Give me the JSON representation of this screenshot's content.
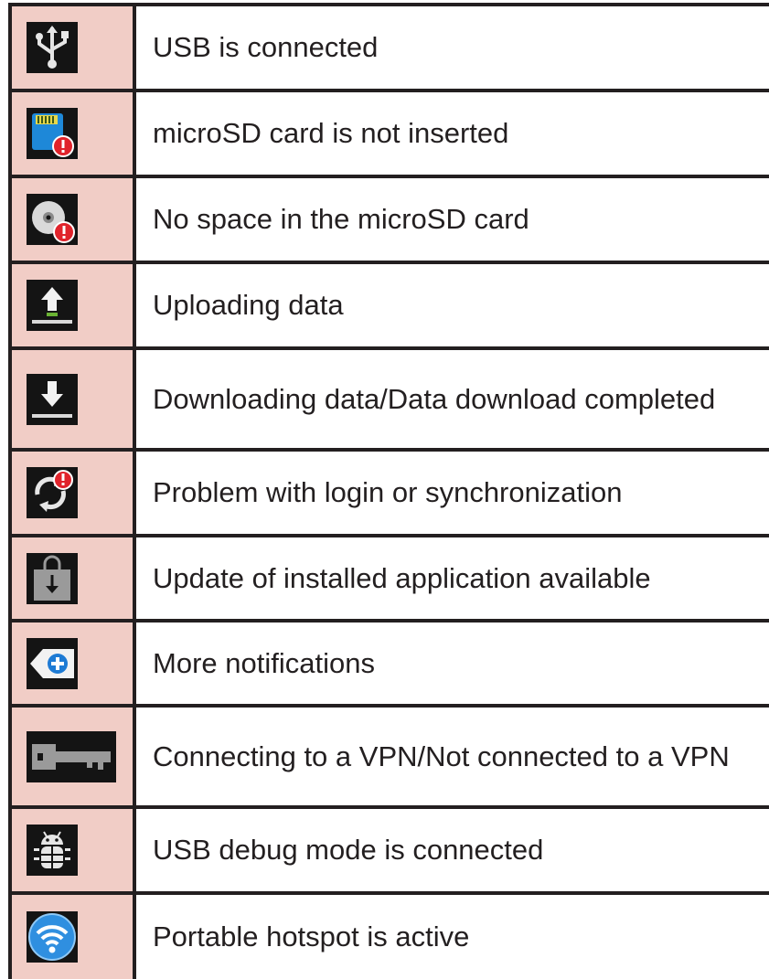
{
  "rows": [
    {
      "icon": "usb-icon",
      "text": "USB is connected"
    },
    {
      "icon": "microsd-not-inserted-icon",
      "text": "microSD card is not inserted"
    },
    {
      "icon": "disk-full-icon",
      "text": "No space in the microSD card"
    },
    {
      "icon": "upload-icon",
      "text": "Uploading data"
    },
    {
      "icon": "download-icon",
      "text": "Downloading data/Data download completed"
    },
    {
      "icon": "sync-problem-icon",
      "text": "Problem with login or synchronization"
    },
    {
      "icon": "app-update-icon",
      "text": "Update of installed application available"
    },
    {
      "icon": "more-notifications-icon",
      "text": "More notifications"
    },
    {
      "icon": "vpn-key-icon",
      "text": "Connecting to a VPN/Not connected to a VPN"
    },
    {
      "icon": "usb-debug-icon",
      "text": "USB debug mode is connected"
    },
    {
      "icon": "hotspot-icon",
      "text": "Portable hotspot is active"
    }
  ],
  "colors": {
    "icon_column_bg": "#f1cdc6",
    "border": "#231f20",
    "alert_red": "#e0232b"
  }
}
